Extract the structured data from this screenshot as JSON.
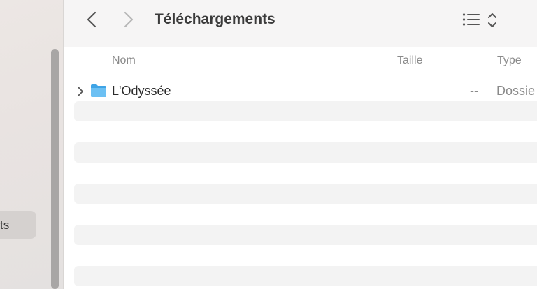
{
  "sidebar": {
    "selected_item_label": "ts"
  },
  "toolbar": {
    "title": "Téléchargements",
    "back_icon": "chevron-left-icon",
    "forward_icon": "chevron-right-icon",
    "view_icon": "list-view-icon"
  },
  "columns": [
    {
      "label": "Nom"
    },
    {
      "label": "Taille"
    },
    {
      "label": "Type"
    }
  ],
  "files": [
    {
      "name": "L'Odyssée",
      "size": "--",
      "type": "Dossie"
    }
  ],
  "colors": {
    "folder": "#5bb6f0",
    "selection": "#d5d1cf"
  }
}
